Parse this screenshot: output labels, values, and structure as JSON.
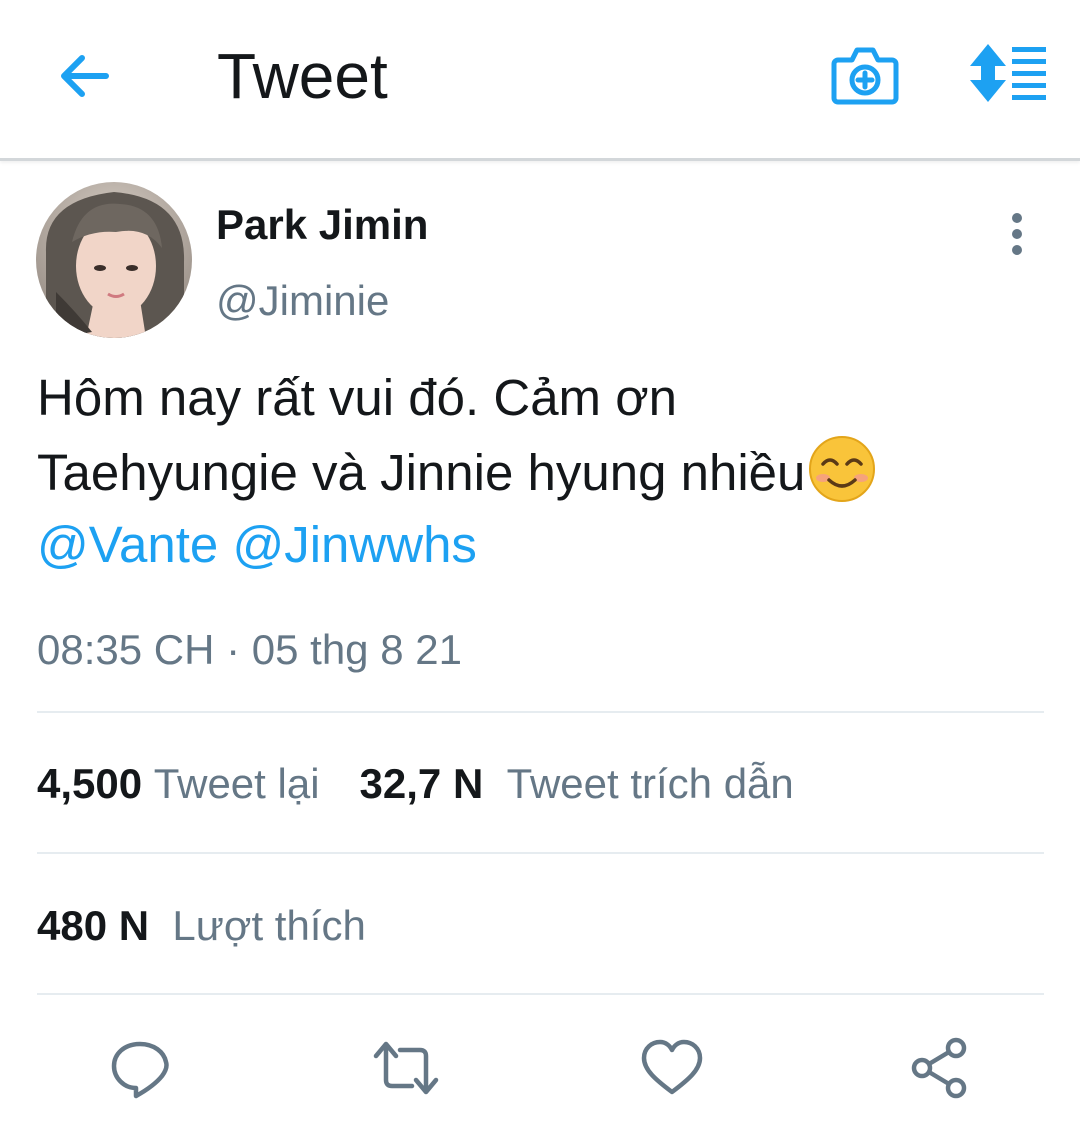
{
  "header": {
    "title": "Tweet",
    "icons": {
      "back": "arrow-left-icon",
      "camera": "camera-add-icon",
      "sort": "sort-list-icon"
    }
  },
  "tweet": {
    "author": {
      "name": "Park Jimin",
      "handle": "@Jiminie"
    },
    "text_line_1": "Hôm nay rất vui đó. Cảm ơn",
    "text_line_2": "Taehyungie và Jinnie hyung nhiều",
    "emoji": "smiling-face-icon",
    "mentions": [
      "@Vante",
      "@Jinwwhs"
    ],
    "timestamp": "08:35 CH · 05 thg 8 21"
  },
  "stats": {
    "retweets": {
      "count": "4,500",
      "label": "Tweet lại"
    },
    "quotes": {
      "count": "32,7 N",
      "label": "Tweet trích dẫn"
    },
    "likes": {
      "count": "480 N",
      "label": "Lượt thích"
    }
  },
  "actions": [
    "reply-icon",
    "retweet-icon",
    "like-icon",
    "share-icon"
  ],
  "colors": {
    "accent": "#1da1f2",
    "text": "#14171a",
    "secondary": "#657786",
    "divider": "#e6ecf0"
  }
}
